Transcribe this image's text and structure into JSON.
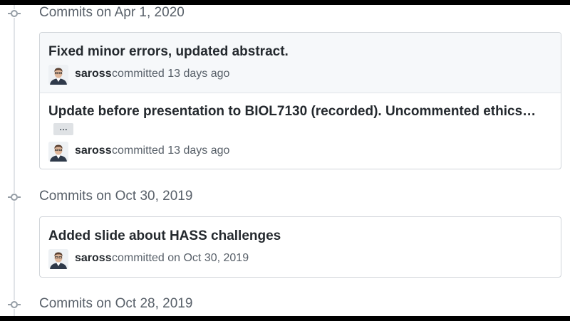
{
  "groups": [
    {
      "title": "Commits on Apr 1, 2020",
      "commits": [
        {
          "message": "Fixed minor errors, updated abstract.",
          "author": "saross",
          "committed": "committed 13 days ago"
        },
        {
          "message": "Update before presentation to BIOL7130 (recorded). Uncommented ethics…",
          "expand_label": "…",
          "author": "saross",
          "committed": "committed 13 days ago"
        }
      ]
    },
    {
      "title": "Commits on Oct 30, 2019",
      "commits": [
        {
          "message": "Added slide about HASS challenges",
          "author": "saross",
          "committed": "committed on Oct 30, 2019"
        }
      ]
    },
    {
      "title": "Commits on Oct 28, 2019",
      "commits": []
    }
  ],
  "colors": {
    "timeline": "#e1e4e8",
    "node": "#959da5",
    "border": "#d1d5da",
    "hover_bg": "#f6f8fa",
    "text": "#24292e",
    "muted": "#586069"
  },
  "icons": {
    "timeline_node": "git-commit-icon",
    "avatar": "user-avatar"
  }
}
